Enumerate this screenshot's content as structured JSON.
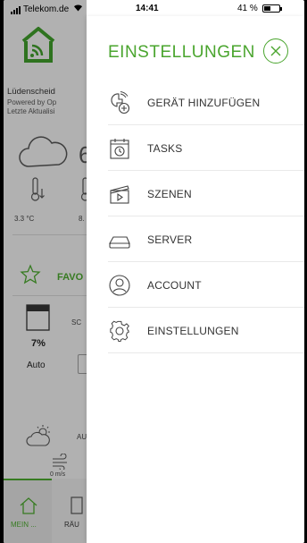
{
  "statusbar": {
    "carrier": "Telekom.de",
    "time": "14:41",
    "battery": "41 %"
  },
  "background": {
    "location": "Lüdenscheid",
    "powered_by": "Powered by Op",
    "last_update": "Letzte Aktualisi",
    "temp_big": "6",
    "temp_min": "3.3 °C",
    "temp_max": "8.",
    "favorites": "FAVO",
    "shade_label": "SC",
    "shade_percent": "7%",
    "shade_mode": "Auto",
    "weather_label": "AU",
    "wind_value": "0 m/s",
    "tab_home": "MEIN ...",
    "tab_rooms": "RÄU"
  },
  "drawer": {
    "title": "EINSTELLUNGEN",
    "items": [
      {
        "label": "GERÄT HINZUFÜGEN",
        "icon": "add-device-icon"
      },
      {
        "label": "TASKS",
        "icon": "calendar-clock-icon"
      },
      {
        "label": "SZENEN",
        "icon": "clapperboard-icon"
      },
      {
        "label": "SERVER",
        "icon": "server-icon"
      },
      {
        "label": "ACCOUNT",
        "icon": "account-icon"
      },
      {
        "label": "EINSTELLUNGEN",
        "icon": "gear-icon"
      }
    ]
  },
  "colors": {
    "accent": "#4aa52e",
    "text": "#333333",
    "divider": "#e9e9e9"
  }
}
